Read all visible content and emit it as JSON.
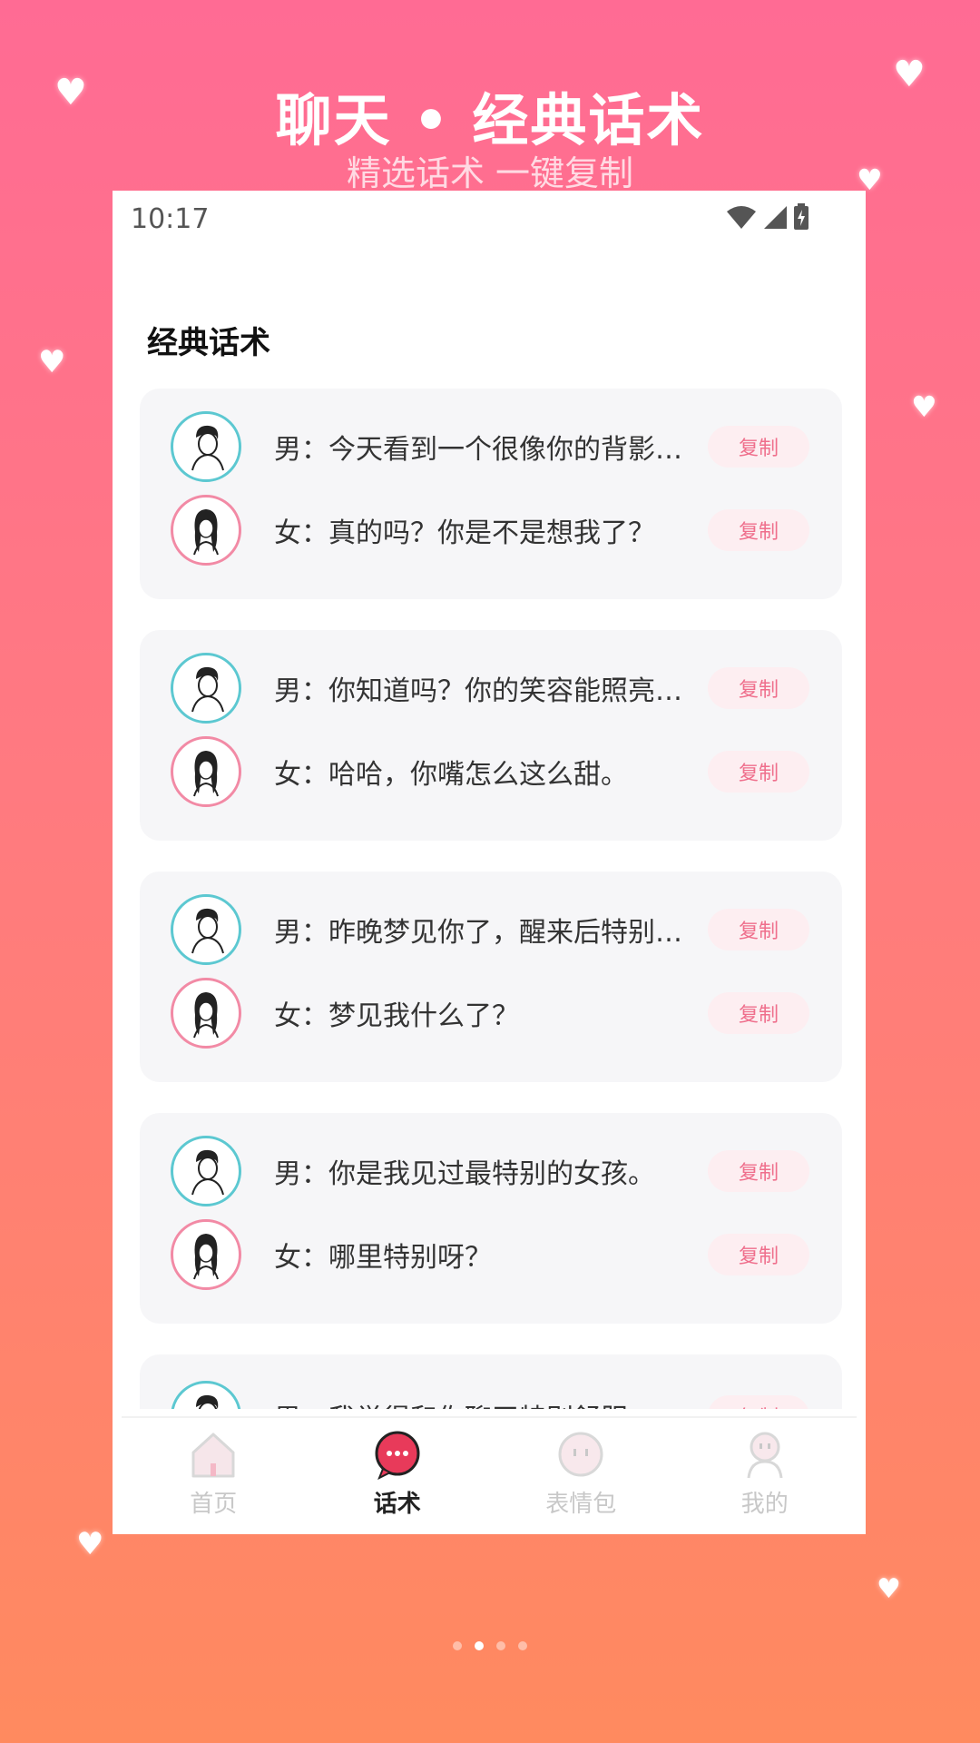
{
  "promo": {
    "title": "聊天 • 经典话术",
    "subtitle": "精选话术 一键复制"
  },
  "status_bar": {
    "time": "10:17",
    "icons": [
      "wifi-icon",
      "cellular-signal-icon",
      "battery-charging-icon"
    ]
  },
  "page": {
    "title": "经典话术"
  },
  "conversations": [
    {
      "male": "男：今天看到一个很像你的背影，心跳都漏了一拍。",
      "female": "女：真的吗？你是不是想我了？",
      "copy_label": "复制"
    },
    {
      "male": "男：你知道吗？你的笑容能照亮我整个世界。",
      "female": "女：哈哈，你嘴怎么这么甜。",
      "copy_label": "复制"
    },
    {
      "male": "男：昨晚梦见你了，醒来后特别想见你。",
      "female": "女：梦见我什么了？",
      "copy_label": "复制"
    },
    {
      "male": "男：你是我见过最特别的女孩。",
      "female": "女：哪里特别呀？",
      "copy_label": "复制"
    },
    {
      "male": "男：我觉得和你聊天特别舒服。",
      "female": "",
      "copy_label": "复制"
    }
  ],
  "tabbar": {
    "items": [
      {
        "label": "首页",
        "icon": "home-icon"
      },
      {
        "label": "话术",
        "icon": "chat-bubble-icon"
      },
      {
        "label": "表情包",
        "icon": "emoji-icon"
      },
      {
        "label": "我的",
        "icon": "profile-icon"
      }
    ],
    "active_index": 1
  },
  "pager": {
    "count": 4,
    "active_index": 1
  },
  "colors": {
    "accent": "#ef6f8c",
    "male_ring": "#5cc8d1",
    "female_ring": "#f28aa5",
    "tab_active": "#e83a5a"
  }
}
